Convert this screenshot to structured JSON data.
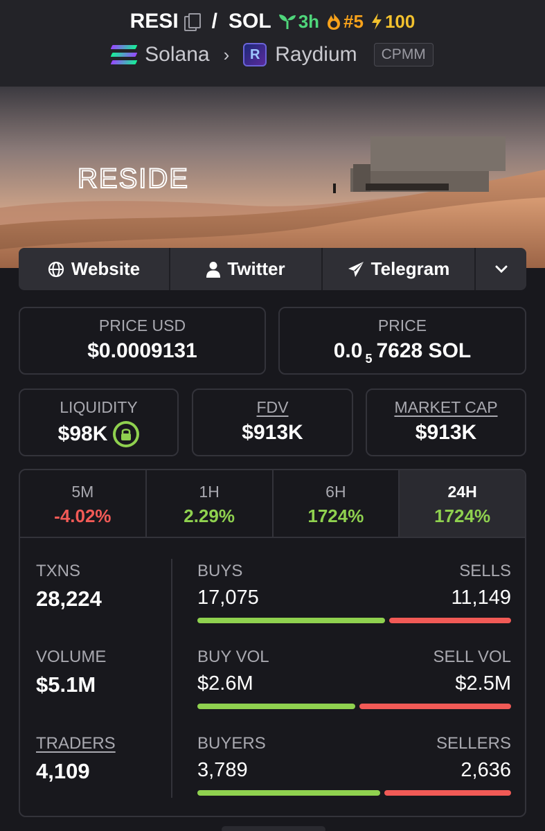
{
  "header": {
    "base_symbol": "RESI",
    "separator": "/",
    "quote_symbol": "SOL",
    "age": "3h",
    "rank": "#5",
    "boost": "100",
    "chain": "Solana",
    "dex": "Raydium",
    "dex_logo_letter": "R",
    "pool_type": "CPMM",
    "icons": [
      "copy-icon",
      "sprout-icon",
      "flame-icon",
      "lightning-icon",
      "solana-logo-icon",
      "raydium-logo-icon"
    ]
  },
  "banner": {
    "text": "RESIDE"
  },
  "links": {
    "website": "Website",
    "twitter": "Twitter",
    "telegram": "Telegram"
  },
  "price": {
    "usd_label": "PRICE USD",
    "usd_value": "$0.0009131",
    "native_label": "PRICE",
    "native_prefix": "0.0",
    "native_zeros": "5",
    "native_value": "7628 SOL"
  },
  "metrics": {
    "liquidity_label": "LIQUIDITY",
    "liquidity_value": "$98K",
    "fdv_label": "FDV",
    "fdv_value": "$913K",
    "mcap_label": "MARKET CAP",
    "mcap_value": "$913K"
  },
  "timeframes": [
    {
      "label": "5M",
      "change": "-4.02%"
    },
    {
      "label": "1H",
      "change": "2.29%"
    },
    {
      "label": "6H",
      "change": "1724%"
    },
    {
      "label": "24H",
      "change": "1724%"
    }
  ],
  "stats": {
    "txns_label": "TXNS",
    "txns_value": "28,224",
    "volume_label": "VOLUME",
    "volume_value": "$5.1M",
    "traders_label": "TRADERS",
    "traders_value": "4,109",
    "buys_label": "BUYS",
    "buys_value": "17,075",
    "sells_label": "SELLS",
    "sells_value": "11,149",
    "buys_fraction": 0.605,
    "buy_vol_label": "BUY VOL",
    "buy_vol_value": "$2.6M",
    "sell_vol_label": "SELL VOL",
    "sell_vol_value": "$2.5M",
    "buy_vol_fraction": 0.51,
    "buyers_label": "BUYERS",
    "buyers_value": "3,789",
    "sellers_label": "SELLERS",
    "sellers_value": "2,636",
    "buyers_fraction": 0.59
  },
  "colors": {
    "positive": "#8fd14f",
    "negative": "#f15a56",
    "background": "#18181d"
  }
}
